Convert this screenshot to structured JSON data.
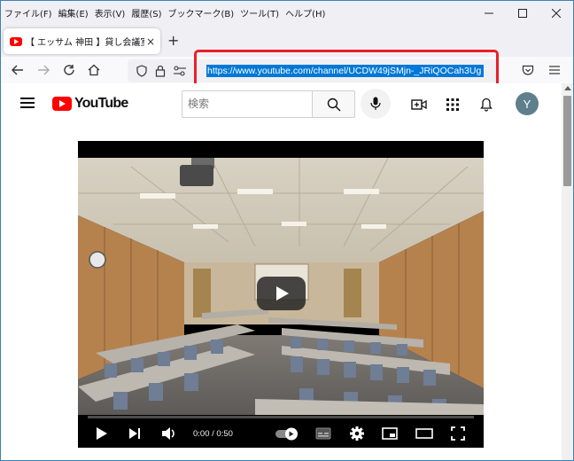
{
  "menu": {
    "items": [
      "ファイル(F)",
      "編集(E)",
      "表示(V)",
      "履歴(S)",
      "ブックマーク(B)",
      "ツール(T)",
      "ヘルプ(H)"
    ]
  },
  "tab": {
    "title": "【 エッサム 神田 】貸し会議室 貸し",
    "close": "×",
    "new_tab": "+"
  },
  "url": {
    "text": "https://www.youtube.com/channel/UCDW49jSMjn-_JRiQOCah3Ug"
  },
  "youtube": {
    "logo_text": "YouTube",
    "search_placeholder": "検索",
    "avatar_letter": "Y"
  },
  "player": {
    "time": "0:00 / 0:50",
    "progress_fraction": 0
  },
  "colors": {
    "highlight_box": "#e8202a",
    "url_selection": "#0078d7",
    "youtube_red": "#ff0000"
  }
}
